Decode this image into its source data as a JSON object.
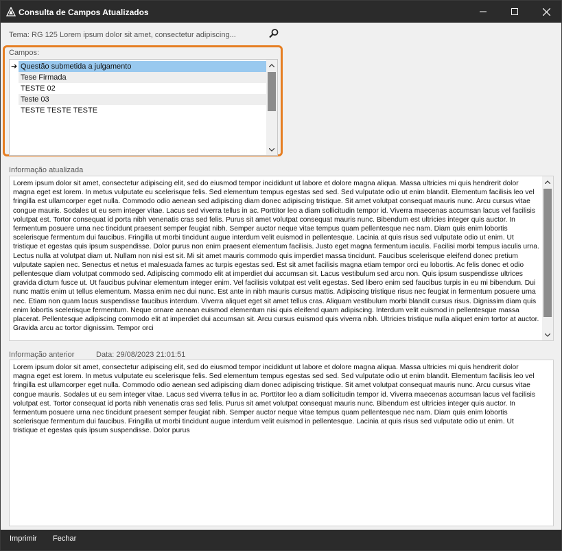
{
  "window": {
    "title": "Consulta de Campos Atualizados"
  },
  "tema": {
    "label": "Tema: RG 125 Lorem ipsum dolor sit amet, consectetur adipiscing..."
  },
  "campos": {
    "label": "Campos:",
    "items": [
      {
        "label": "Questão submetida a julgamento",
        "selected": true
      },
      {
        "label": "Tese Firmada",
        "selected": false
      },
      {
        "label": "TESTE 02",
        "selected": false
      },
      {
        "label": "Teste 03",
        "selected": false
      },
      {
        "label": "TESTE TESTE TESTE",
        "selected": false
      }
    ]
  },
  "info_atualizada": {
    "label": "Informação atualizada",
    "text": "Lorem ipsum dolor sit amet, consectetur adipiscing elit, sed do eiusmod tempor incididunt ut labore et dolore magna aliqua. Massa ultricies mi quis hendrerit dolor magna eget est lorem. In metus vulputate eu scelerisque felis. Sed elementum tempus egestas sed sed. Sed vulputate odio ut enim blandit. Elementum facilisis leo vel fringilla est ullamcorper eget nulla. Commodo odio aenean sed adipiscing diam donec adipiscing tristique. Sit amet volutpat consequat mauris nunc. Arcu cursus vitae congue mauris. Sodales ut eu sem integer vitae. Lacus sed viverra tellus in ac. Porttitor leo a diam sollicitudin tempor id. Viverra maecenas accumsan lacus vel facilisis volutpat est. Tortor consequat id porta nibh venenatis cras sed felis. Purus sit amet volutpat consequat mauris nunc. Bibendum est ultricies integer quis auctor. In fermentum posuere urna nec tincidunt praesent semper feugiat nibh. Semper auctor neque vitae tempus quam pellentesque nec nam. Diam quis enim lobortis scelerisque fermentum dui faucibus. Fringilla ut morbi tincidunt augue interdum velit euismod in pellentesque. Lacinia at quis risus sed vulputate odio ut enim. Ut tristique et egestas quis ipsum suspendisse. Dolor purus non enim praesent elementum facilisis. Justo eget magna fermentum iaculis. Facilisi morbi tempus iaculis urna. Lectus nulla at volutpat diam ut. Nullam non nisi est sit. Mi sit amet mauris commodo quis imperdiet massa tincidunt. Faucibus scelerisque eleifend donec pretium vulputate sapien nec. Senectus et netus et malesuada fames ac turpis egestas sed. Est sit amet facilisis magna etiam tempor orci eu lobortis. Ac felis donec et odio pellentesque diam volutpat commodo sed. Adipiscing commodo elit at imperdiet dui accumsan sit. Lacus vestibulum sed arcu non. Quis ipsum suspendisse ultrices gravida dictum fusce ut. Ut faucibus pulvinar elementum integer enim. Vel facilisis volutpat est velit egestas. Sed libero enim sed faucibus turpis in eu mi bibendum. Dui nunc mattis enim ut tellus elementum. Massa enim nec dui nunc. Est ante in nibh mauris cursus mattis. Adipiscing tristique risus nec feugiat in fermentum posuere urna nec. Etiam non quam lacus suspendisse faucibus interdum. Viverra aliquet eget sit amet tellus cras. Aliquam vestibulum morbi blandit cursus risus. Dignissim diam quis enim lobortis scelerisque fermentum. Neque ornare aenean euismod elementum nisi quis eleifend quam adipiscing. Interdum velit euismod in pellentesque massa placerat. Pellentesque adipiscing commodo elit at imperdiet dui accumsan sit. Arcu cursus euismod quis viverra nibh. Ultricies tristique nulla aliquet enim tortor at auctor. Gravida arcu ac tortor dignissim. Tempor orci"
  },
  "info_anterior": {
    "label": "Informação anterior",
    "date_label": "Data: 29/08/2023 21:01:51",
    "text": "Lorem ipsum dolor sit amet, consectetur adipiscing elit, sed do eiusmod tempor incididunt ut labore et dolore magna aliqua. Massa ultricies mi quis hendrerit dolor magna eget est lorem. In metus vulputate eu scelerisque felis. Sed elementum tempus egestas sed sed. Sed vulputate odio ut enim blandit. Elementum facilisis leo vel fringilla est ullamcorper eget nulla. Commodo odio aenean sed adipiscing diam donec adipiscing tristique. Sit amet volutpat consequat mauris nunc. Arcu cursus vitae congue mauris. Sodales ut eu sem integer vitae. Lacus sed viverra tellus in ac. Porttitor leo a diam sollicitudin tempor id. Viverra maecenas accumsan lacus vel facilisis volutpat est. Tortor consequat id porta nibh venenatis cras sed felis. Purus sit amet volutpat consequat mauris nunc. Bibendum est ultricies integer quis auctor. In fermentum posuere urna nec tincidunt praesent semper feugiat nibh. Semper auctor neque vitae tempus quam pellentesque nec nam. Diam quis enim lobortis scelerisque fermentum dui faucibus. Fringilla ut morbi tincidunt augue interdum velit euismod in pellentesque. Lacinia at quis risus sed vulputate odio ut enim. Ut tristique et egestas quis ipsum suspendisse. Dolor purus"
  },
  "footer": {
    "print_label": "Imprimir",
    "close_label": "Fechar"
  },
  "colors": {
    "titlebar": "#2b2b2b",
    "highlight": "#e67e22",
    "selection": "#99c9ef"
  }
}
